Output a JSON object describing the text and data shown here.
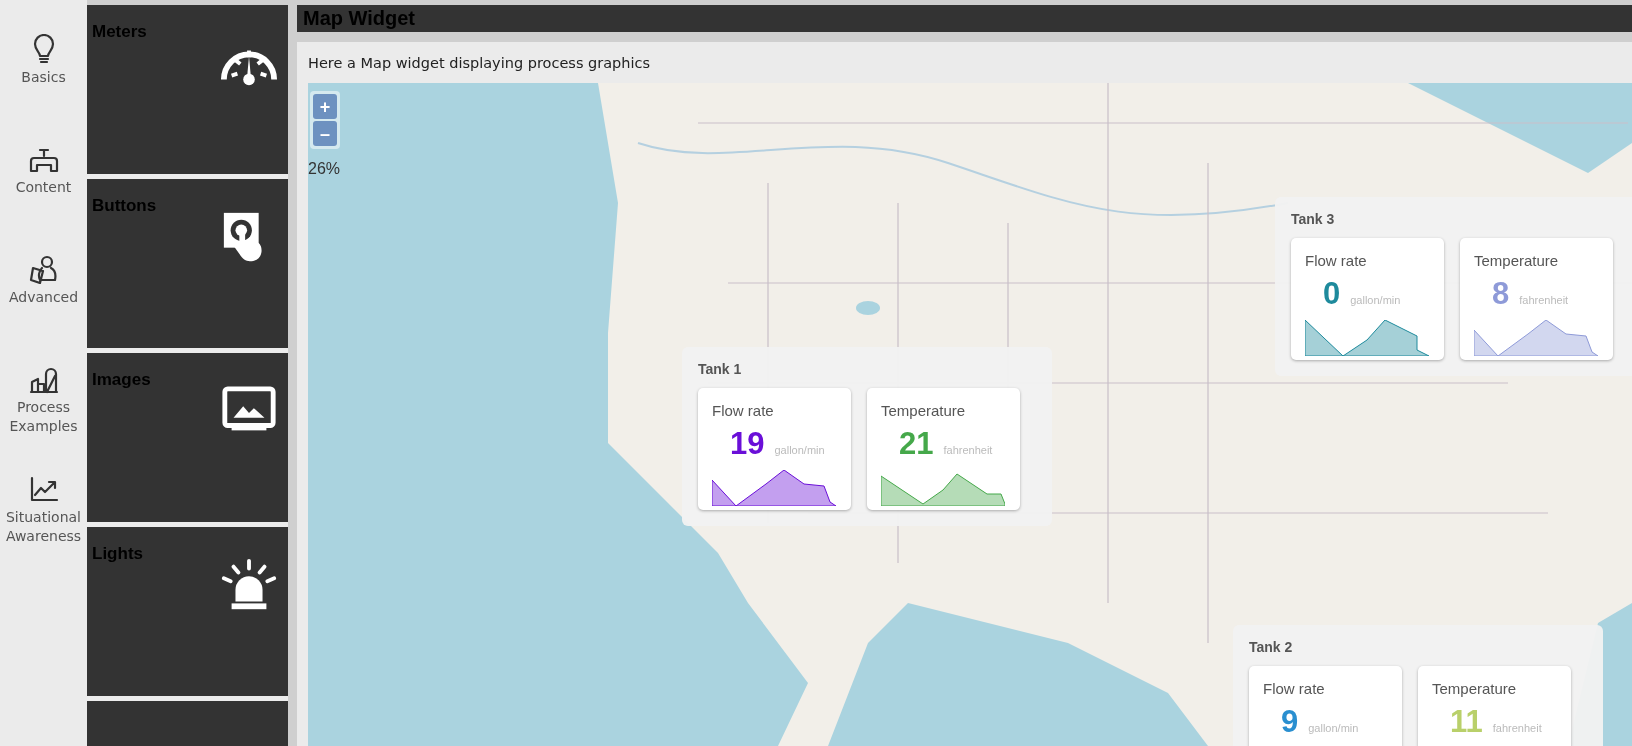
{
  "nav": [
    {
      "label": "Basics"
    },
    {
      "label": "Content"
    },
    {
      "label": "Advanced"
    },
    {
      "label": "Process Examples"
    },
    {
      "label": "Situational Awareness"
    }
  ],
  "tiles": [
    {
      "title": "Meters"
    },
    {
      "title": "Buttons"
    },
    {
      "title": "Images"
    },
    {
      "title": "Lights"
    }
  ],
  "header": {
    "title": "Map Widget"
  },
  "description": "Here a Map widget displaying process graphics",
  "map": {
    "zoom_in": "+",
    "zoom_out": "–",
    "zoom_level": "26%",
    "tanks": [
      {
        "title": "Tank 3",
        "readings": [
          {
            "label": "Flow rate",
            "value": "0",
            "unit": "gallon/min",
            "color": "#1e8a9c",
            "sparkline": true
          },
          {
            "label": "Temperature",
            "value": "8",
            "unit": "fahrenheit",
            "color": "#8e9ad8",
            "sparkline": true
          }
        ]
      },
      {
        "title": "Tank 1",
        "readings": [
          {
            "label": "Flow rate",
            "value": "19",
            "unit": "gallon/min",
            "color": "#6a0fd8",
            "sparkline": true
          },
          {
            "label": "Temperature",
            "value": "21",
            "unit": "fahrenheit",
            "color": "#45a84a",
            "sparkline": true
          }
        ]
      },
      {
        "title": "Tank 2",
        "readings": [
          {
            "label": "Flow rate",
            "value": "9",
            "unit": "gallon/min",
            "color": "#2a8fd0"
          },
          {
            "label": "Temperature",
            "value": "11",
            "unit": "fahrenheit",
            "color": "#b9d06a"
          }
        ]
      }
    ]
  }
}
